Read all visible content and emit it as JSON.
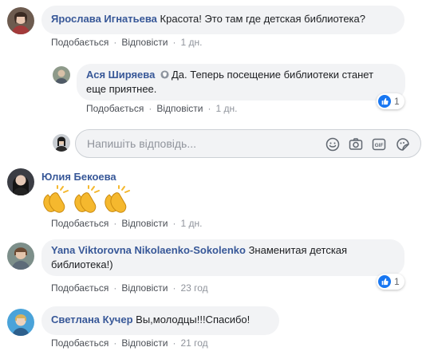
{
  "comments": [
    {
      "author": "Ярослава Игнатьева",
      "text": "Красота! Это там где детская библиотека?",
      "like_label": "Подобається",
      "reply_label": "Відповісти",
      "time": "1 дн."
    },
    {
      "author": "Ася Ширяева",
      "text_line1": "Да. Теперь посещение библиотеки станет",
      "text_line2": "еще приятнее.",
      "like_label": "Подобається",
      "reply_label": "Відповісти",
      "time": "1 дн.",
      "reaction_count": "1"
    },
    {
      "author": "Юлия Бекоева",
      "like_label": "Подобається",
      "reply_label": "Відповісти",
      "time": "1 дн."
    },
    {
      "author": "Yana Viktorovna Nikolaenko-Sokolenko",
      "text_line1": "Знаменитая детская",
      "text_line2": "библиотека!)",
      "like_label": "Подобається",
      "reply_label": "Відповісти",
      "time": "23 год",
      "reaction_count": "1"
    },
    {
      "author": "Светлана Кучер",
      "text": "Вы,молодцы!!!Спасибо!",
      "like_label": "Подобається",
      "reply_label": "Відповісти",
      "time": "21 год"
    }
  ],
  "reply_input": {
    "placeholder": "Напишіть відповідь..."
  },
  "reply_tools": [
    "emoji-icon",
    "camera-icon",
    "gif-icon",
    "sticker-icon"
  ],
  "colors": {
    "author": "#385898",
    "bubble": "#f2f3f5",
    "meta": "#90949c",
    "like_badge": "#1877f2"
  }
}
